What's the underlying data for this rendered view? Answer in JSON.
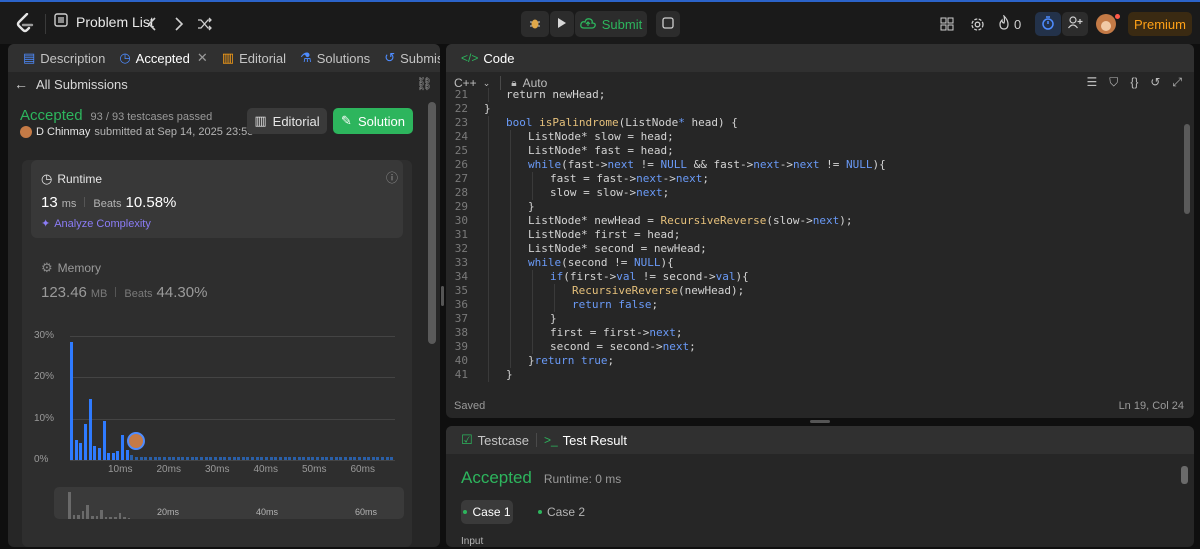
{
  "topbar": {
    "problem_list": "Problem List",
    "submit": "Submit",
    "streak": "0",
    "premium": "Premium",
    "colors": {
      "accent": "#2db55d",
      "premium": "#ffa116",
      "brand_border": "#2b63c9"
    }
  },
  "left_tabs": {
    "description": "Description",
    "accepted": "Accepted",
    "editorial": "Editorial",
    "solutions": "Solutions",
    "submissions": "Submissions"
  },
  "submission": {
    "back": "All Submissions",
    "status": "Accepted",
    "testcases": "93 / 93 testcases passed",
    "author": "D Chinmay",
    "submitted_at": "submitted at Sep 14, 2025 23:55",
    "editorial_btn": "Editorial",
    "solution_btn": "Solution",
    "runtime": {
      "label": "Runtime",
      "value": "13",
      "unit": "ms",
      "beats_label": "Beats",
      "beats": "10.58%",
      "analyze": "Analyze Complexity"
    },
    "memory": {
      "label": "Memory",
      "value": "123.46",
      "unit": "MB",
      "beats_label": "Beats",
      "beats": "44.30%"
    }
  },
  "chart_data": {
    "type": "bar",
    "y_ticks": [
      "30%",
      "20%",
      "10%",
      "0%"
    ],
    "ylim": [
      0,
      30
    ],
    "x_ticks": [
      "10ms",
      "20ms",
      "30ms",
      "40ms",
      "50ms",
      "60ms"
    ],
    "mini_x_ticks": [
      "20ms",
      "40ms",
      "60ms"
    ],
    "values": [
      28.5,
      4.8,
      4.0,
      8.8,
      14.8,
      3.5,
      3.0,
      9.5,
      1.8,
      1.8,
      2.2,
      6.0,
      2.4,
      1.2,
      0.8,
      0.8,
      0.8,
      0.8,
      0.8,
      0.8,
      0.8,
      0.8,
      0.8,
      0.8,
      0.8,
      0.8,
      0.8,
      0.8,
      0.8,
      0.8,
      0.8,
      0.8,
      0.8,
      0.8,
      0.8,
      0.8,
      0.8,
      0.8,
      0.8,
      0.8,
      0.8,
      0.8,
      0.8,
      0.8,
      0.8,
      0.8,
      0.8,
      0.8,
      0.8,
      0.8,
      0.8,
      0.8,
      0.8,
      0.8,
      0.8,
      0.8,
      0.8,
      0.8,
      0.8,
      0.8,
      0.8,
      0.8,
      0.8,
      0.8,
      0.8,
      0.8,
      0.8,
      0.8,
      0.8,
      0.8
    ]
  },
  "code_panel": {
    "title": "Code",
    "language": "C++",
    "auto": "Auto",
    "saved": "Saved",
    "cursor": "Ln 19, Col 24",
    "lines": [
      {
        "n": "21",
        "indent": 1,
        "parts": [
          [
            "t",
            "return newHead;"
          ]
        ]
      },
      {
        "n": "22",
        "indent": 0,
        "parts": [
          [
            "t",
            "}"
          ]
        ]
      },
      {
        "n": "23",
        "indent": 1,
        "parts": [
          [
            "k",
            "bool "
          ],
          [
            "f",
            "isPalindrome"
          ],
          [
            "t",
            "("
          ],
          [
            "t",
            "ListNode"
          ],
          [
            "k",
            "* "
          ],
          [
            "t",
            "head) {"
          ]
        ]
      },
      {
        "n": "24",
        "indent": 2,
        "parts": [
          [
            "t",
            "ListNode* slow = head;"
          ]
        ]
      },
      {
        "n": "25",
        "indent": 2,
        "parts": [
          [
            "t",
            "ListNode* fast = head;"
          ]
        ]
      },
      {
        "n": "26",
        "indent": 2,
        "parts": [
          [
            "k",
            "while"
          ],
          [
            "t",
            "(fast->"
          ],
          [
            "k",
            "next"
          ],
          [
            "t",
            " != "
          ],
          [
            "k",
            "NULL"
          ],
          [
            "t",
            " && fast->"
          ],
          [
            "k",
            "next"
          ],
          [
            "t",
            "->"
          ],
          [
            "k",
            "next"
          ],
          [
            "t",
            " != "
          ],
          [
            "k",
            "NULL"
          ],
          [
            "t",
            "){"
          ]
        ]
      },
      {
        "n": "27",
        "indent": 3,
        "parts": [
          [
            "t",
            "fast = fast->"
          ],
          [
            "k",
            "next"
          ],
          [
            "t",
            "->"
          ],
          [
            "k",
            "next"
          ],
          [
            "t",
            ";"
          ]
        ]
      },
      {
        "n": "28",
        "indent": 3,
        "parts": [
          [
            "t",
            "slow = slow->"
          ],
          [
            "k",
            "next"
          ],
          [
            "t",
            ";"
          ]
        ]
      },
      {
        "n": "29",
        "indent": 2,
        "parts": [
          [
            "t",
            "}"
          ]
        ]
      },
      {
        "n": "30",
        "indent": 2,
        "parts": [
          [
            "t",
            "ListNode* newHead = "
          ],
          [
            "f",
            "RecursiveReverse"
          ],
          [
            "t",
            "(slow->"
          ],
          [
            "k",
            "next"
          ],
          [
            "t",
            ");"
          ]
        ]
      },
      {
        "n": "31",
        "indent": 2,
        "parts": [
          [
            "t",
            "ListNode* first = head;"
          ]
        ]
      },
      {
        "n": "32",
        "indent": 2,
        "parts": [
          [
            "t",
            "ListNode* second = newHead;"
          ]
        ]
      },
      {
        "n": "33",
        "indent": 2,
        "parts": [
          [
            "k",
            "while"
          ],
          [
            "t",
            "(second != "
          ],
          [
            "k",
            "NULL"
          ],
          [
            "t",
            "){"
          ]
        ]
      },
      {
        "n": "34",
        "indent": 3,
        "parts": [
          [
            "k",
            "if"
          ],
          [
            "t",
            "(first->"
          ],
          [
            "k",
            "val"
          ],
          [
            "t",
            " != second->"
          ],
          [
            "k",
            "val"
          ],
          [
            "t",
            "){"
          ]
        ]
      },
      {
        "n": "35",
        "indent": 4,
        "parts": [
          [
            "f",
            "RecursiveReverse"
          ],
          [
            "t",
            "(newHead);"
          ]
        ]
      },
      {
        "n": "36",
        "indent": 4,
        "parts": [
          [
            "k",
            "return false"
          ],
          [
            "t",
            ";"
          ]
        ]
      },
      {
        "n": "37",
        "indent": 3,
        "parts": [
          [
            "t",
            "}"
          ]
        ]
      },
      {
        "n": "38",
        "indent": 3,
        "parts": [
          [
            "t",
            "first = first->"
          ],
          [
            "k",
            "next"
          ],
          [
            "t",
            ";"
          ]
        ]
      },
      {
        "n": "39",
        "indent": 3,
        "parts": [
          [
            "t",
            "second = second->"
          ],
          [
            "k",
            "next"
          ],
          [
            "t",
            ";"
          ]
        ]
      },
      {
        "n": "40",
        "indent": 2,
        "parts": [
          [
            "t",
            "}"
          ],
          [
            "k",
            "return true"
          ],
          [
            "t",
            ";"
          ]
        ]
      },
      {
        "n": "41",
        "indent": 1,
        "parts": [
          [
            "t",
            "}"
          ]
        ]
      }
    ]
  },
  "result_panel": {
    "testcase_tab": "Testcase",
    "result_tab": "Test Result",
    "status": "Accepted",
    "runtime": "Runtime: 0 ms",
    "case1": "Case 1",
    "case2": "Case 2",
    "input_label": "Input"
  }
}
